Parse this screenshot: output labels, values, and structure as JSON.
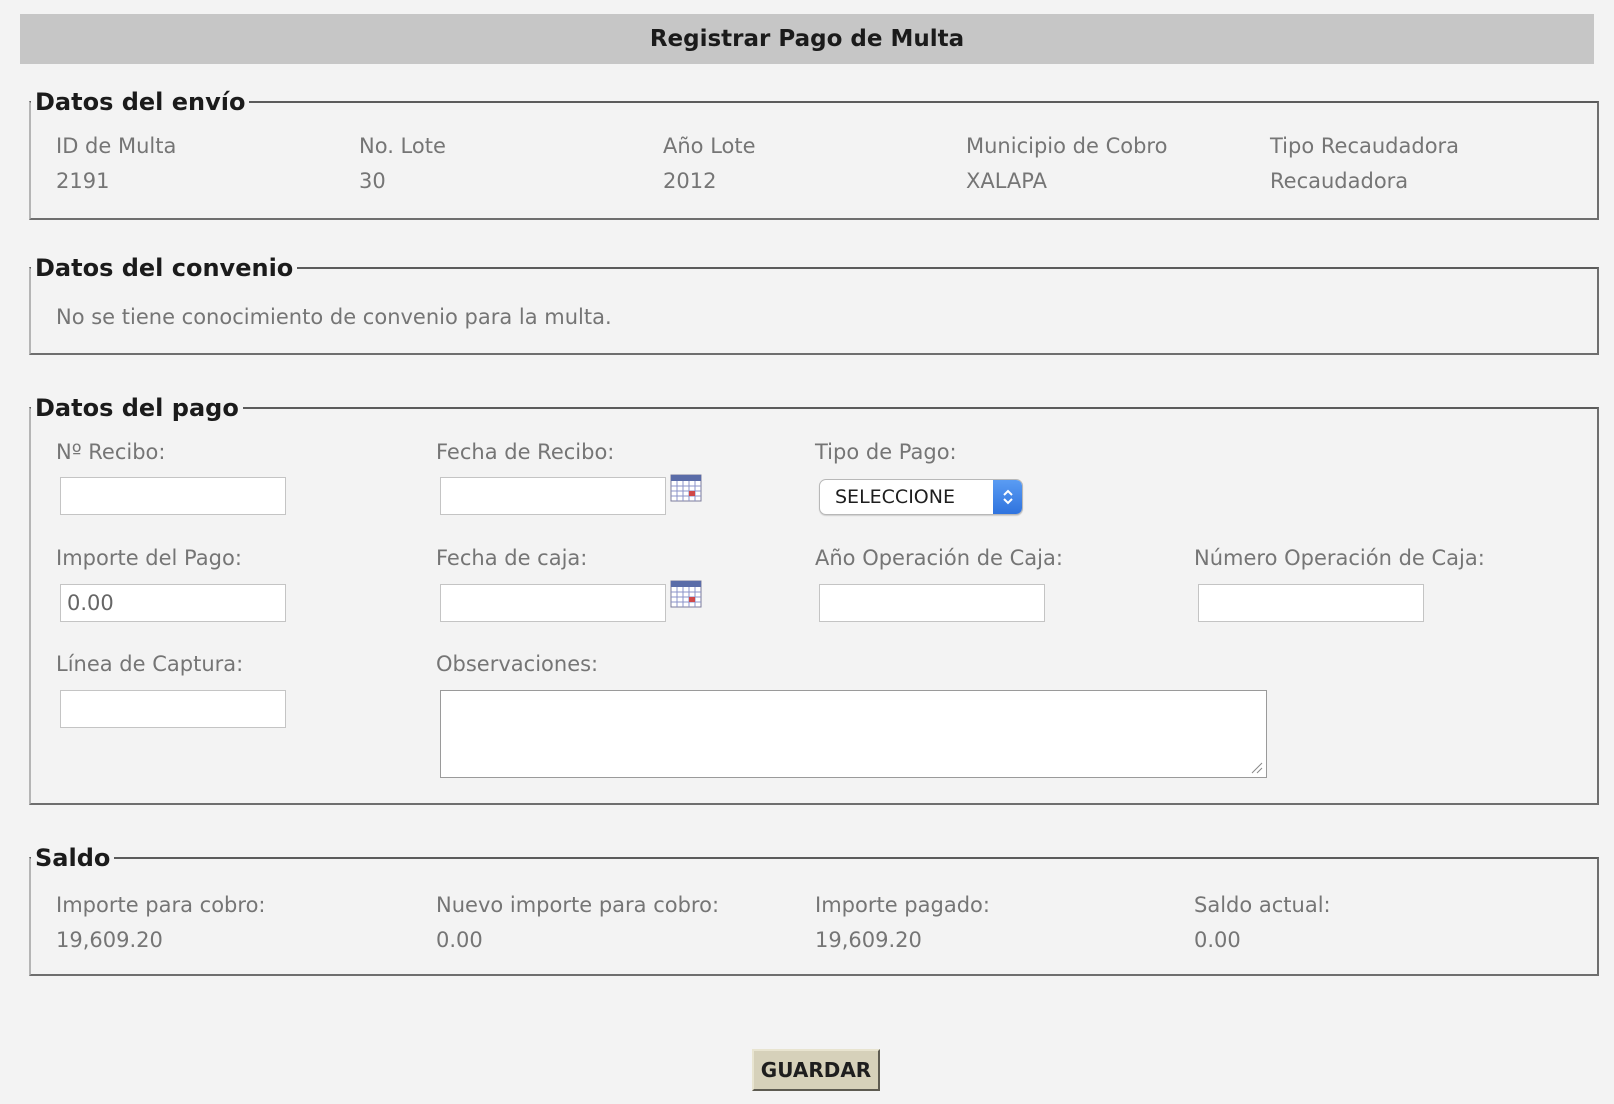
{
  "title": "Registrar Pago de Multa",
  "envio": {
    "legend": "Datos del envío",
    "fields": [
      {
        "label": "ID de Multa",
        "value": "2191"
      },
      {
        "label": "No. Lote",
        "value": "30"
      },
      {
        "label": "Año Lote",
        "value": "2012"
      },
      {
        "label": "Municipio de Cobro",
        "value": "XALAPA"
      },
      {
        "label": "Tipo Recaudadora",
        "value": "Recaudadora"
      }
    ]
  },
  "convenio": {
    "legend": "Datos del convenio",
    "message": "No se tiene conocimiento de convenio para la multa."
  },
  "pago": {
    "legend": "Datos del pago",
    "recibo_label": "Nº Recibo:",
    "recibo_value": "",
    "fecha_recibo_label": "Fecha de Recibo:",
    "fecha_recibo_value": "",
    "tipo_pago_label": "Tipo de Pago:",
    "tipo_pago_selected": "SELECCIONE",
    "importe_label": "Importe del Pago:",
    "importe_value": "0.00",
    "fecha_caja_label": "Fecha de caja:",
    "fecha_caja_value": "",
    "anio_operacion_label": "Año Operación de Caja:",
    "anio_operacion_value": "",
    "numero_operacion_label": "Número Operación de Caja:",
    "numero_operacion_value": "",
    "linea_captura_label": "Línea de Captura:",
    "linea_captura_value": "",
    "observaciones_label": "Observaciones:",
    "observaciones_value": ""
  },
  "saldo": {
    "legend": "Saldo",
    "fields": [
      {
        "label": "Importe para cobro:",
        "value": "19,609.20"
      },
      {
        "label": "Nuevo importe para cobro:",
        "value": "0.00"
      },
      {
        "label": "Importe pagado:",
        "value": "19,609.20"
      },
      {
        "label": "Saldo actual:",
        "value": "0.00"
      }
    ]
  },
  "save_button": "GUARDAR",
  "icons": {
    "calendar": "calendar-icon",
    "select_arrow": "select-arrows-icon",
    "resize": "resize-grip-icon"
  },
  "colors": {
    "title_bar": "#c6c6c6",
    "button": "#d6d1ba",
    "select_arrow": "#2f73de"
  }
}
